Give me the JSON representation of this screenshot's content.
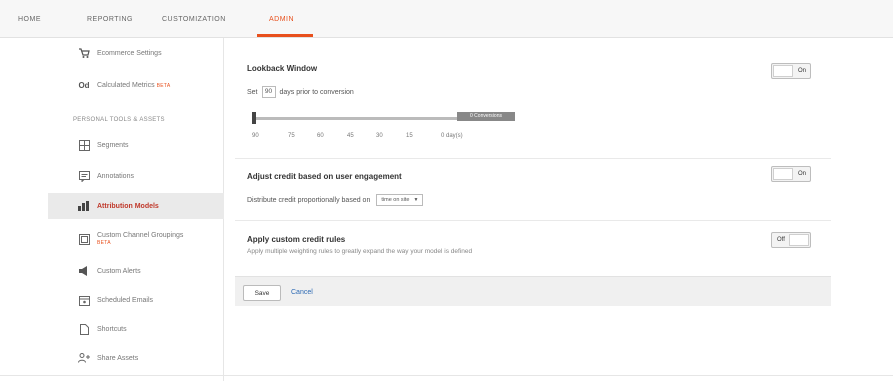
{
  "nav": {
    "items": [
      "HOME",
      "REPORTING",
      "CUSTOMIZATION",
      "ADMIN"
    ],
    "active": "ADMIN"
  },
  "sidebar": {
    "items": [
      {
        "label": "Ecommerce Settings",
        "icon": "cart-icon"
      },
      {
        "label": "Calculated Metrics",
        "beta": "BETA",
        "icon": "calculator-icon"
      },
      {
        "label": "Segments",
        "icon": "segments-icon"
      },
      {
        "label": "Annotations",
        "icon": "annotation-icon"
      },
      {
        "label": "Attribution Models",
        "icon": "attribution-icon"
      },
      {
        "label": "Custom Channel Groupings",
        "beta": "BETA",
        "icon": "channel-grouping-icon"
      },
      {
        "label": "Custom Alerts",
        "icon": "megaphone-icon"
      },
      {
        "label": "Scheduled Emails",
        "icon": "calendar-icon"
      },
      {
        "label": "Shortcuts",
        "icon": "page-icon"
      },
      {
        "label": "Share Assets",
        "icon": "share-icon"
      }
    ],
    "section_header": "PERSONAL TOOLS & ASSETS",
    "active_index": 4
  },
  "lookback": {
    "title": "Lookback Window",
    "set_label": "Set",
    "days_value": "90",
    "suffix": "days prior to conversion",
    "ticks": [
      "90",
      "75",
      "60",
      "45",
      "30",
      "15",
      "0 day(s)"
    ],
    "tag": "0 Conversions",
    "toggle": "On"
  },
  "engagement": {
    "title": "Adjust credit based on user engagement",
    "distribute_label": "Distribute credit proportionally based on",
    "select_value": "time on site",
    "toggle": "On"
  },
  "custom_rules": {
    "title": "Apply custom credit rules",
    "description": "Apply multiple weighting rules to greatly expand the way your model is defined",
    "toggle": "Off"
  },
  "footer": {
    "save": "Save",
    "cancel": "Cancel"
  },
  "colors": {
    "accent": "#e8501d",
    "link": "#2d6ab4",
    "active_label": "#c0392b"
  }
}
